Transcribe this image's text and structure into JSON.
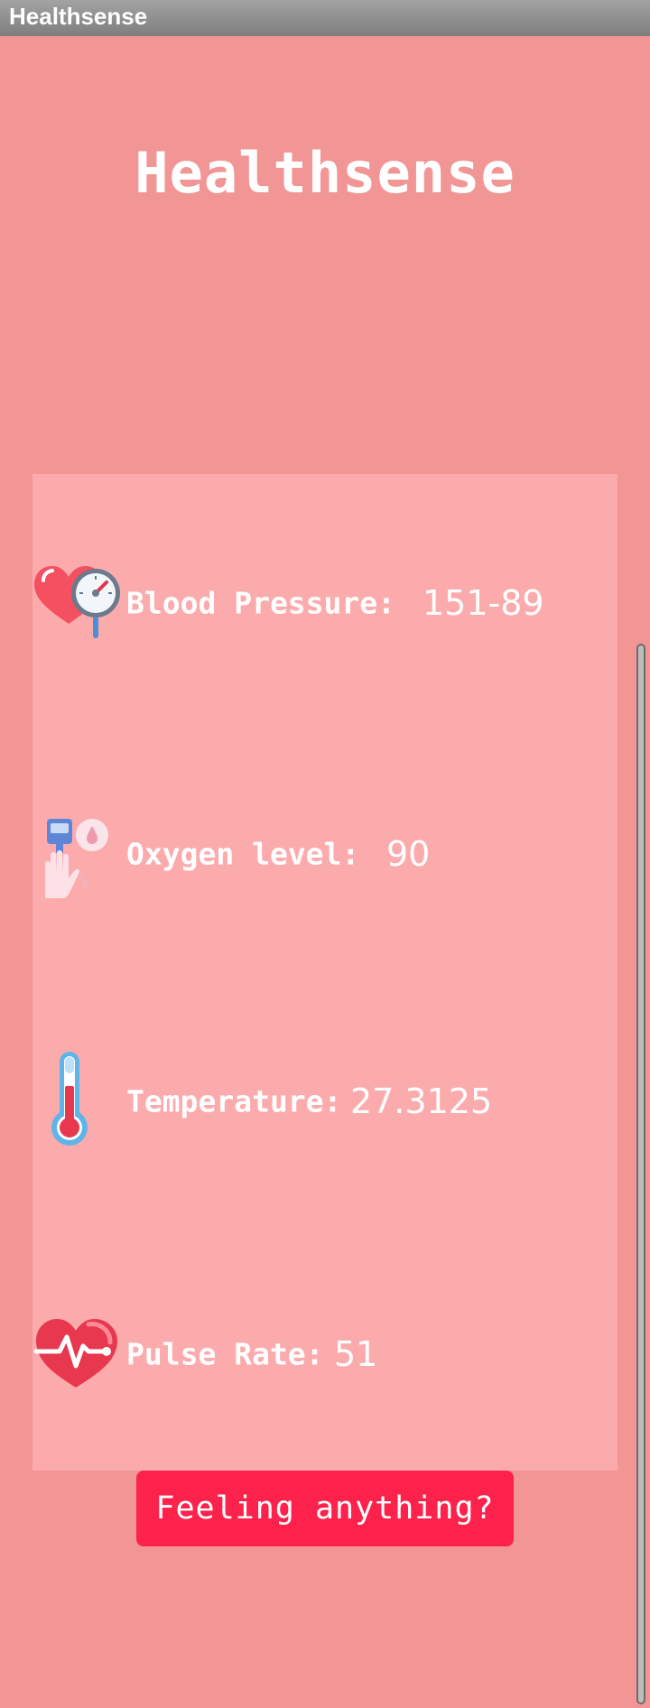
{
  "window": {
    "title": "Healthsense"
  },
  "app": {
    "title": "Healthsense"
  },
  "metrics": {
    "blood_pressure": {
      "label": "Blood Pressure:",
      "value": "151-89",
      "icon": "heart-gauge-icon"
    },
    "oxygen": {
      "label": "Oxygen level:",
      "value": "90",
      "icon": "oximeter-icon"
    },
    "temperature": {
      "label": "Temperature:",
      "value": "27.3125",
      "icon": "thermometer-icon"
    },
    "pulse": {
      "label": "Pulse Rate:",
      "value": "51",
      "icon": "heartbeat-icon"
    }
  },
  "action": {
    "label": "Feeling anything?"
  },
  "colors": {
    "background": "#f29595",
    "card": "#fcabad",
    "button": "#fd224b",
    "text": "#ffffff"
  }
}
